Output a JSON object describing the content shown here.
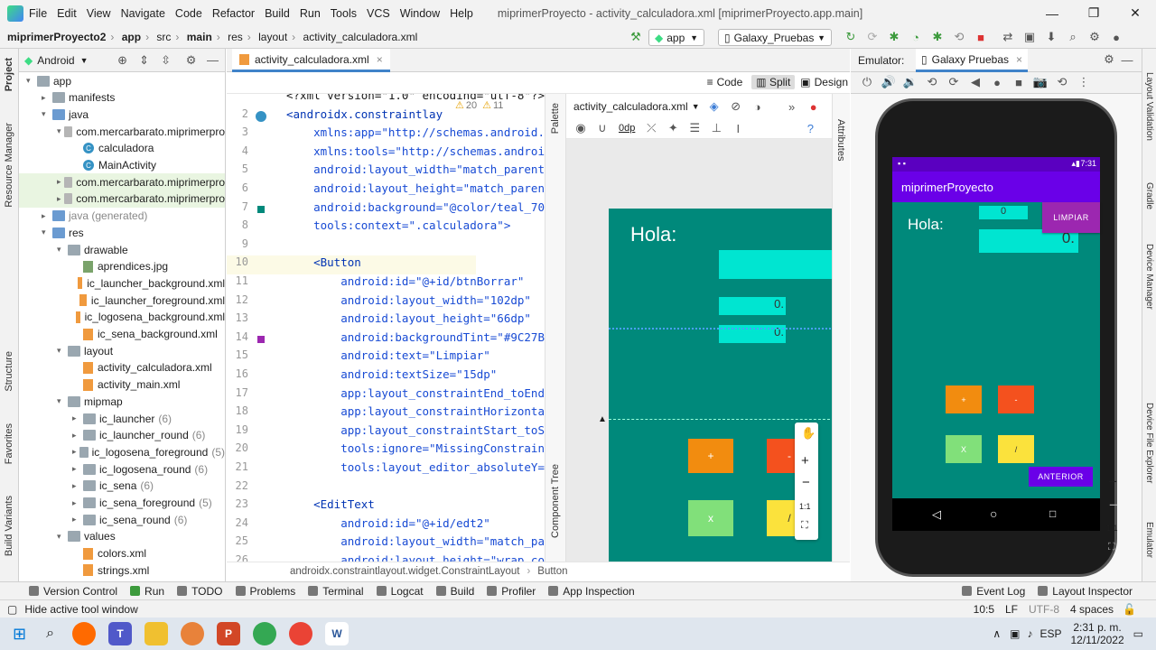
{
  "titlebar": {
    "menu": [
      "File",
      "Edit",
      "View",
      "Navigate",
      "Code",
      "Refactor",
      "Build",
      "Run",
      "Tools",
      "VCS",
      "Window",
      "Help"
    ],
    "title": "miprimerProyecto - activity_calculadora.xml [miprimerProyecto.app.main]"
  },
  "navbar": {
    "crumbs": [
      "miprimerProyecto2",
      "app",
      "src",
      "main",
      "res",
      "layout",
      "activity_calculadora.xml"
    ],
    "run_config": "app",
    "device": "Galaxy_Pruebas"
  },
  "leftstrip": {
    "tabs": [
      "Project",
      "Resource Manager",
      "Structure",
      "Favorites",
      "Build Variants"
    ]
  },
  "project": {
    "view": "Android",
    "items": [
      {
        "label": "app",
        "indent": 0,
        "kind": "folder",
        "arrow": "▾"
      },
      {
        "label": "manifests",
        "indent": 1,
        "kind": "folder",
        "arrow": "▸"
      },
      {
        "label": "java",
        "indent": 1,
        "kind": "folder",
        "arrow": "▾"
      },
      {
        "label": "com.mercarbarato.miprimerpro",
        "indent": 2,
        "kind": "pkg",
        "arrow": "▾"
      },
      {
        "label": "calculadora",
        "indent": 3,
        "kind": "class",
        "arrow": ""
      },
      {
        "label": "MainActivity",
        "indent": 3,
        "kind": "class",
        "arrow": ""
      },
      {
        "label": "com.mercarbarato.miprimerpro",
        "indent": 2,
        "kind": "pkg",
        "arrow": "▸",
        "hl": true
      },
      {
        "label": "com.mercarbarato.miprimerpro",
        "indent": 2,
        "kind": "pkg",
        "arrow": "▸",
        "hl": true
      },
      {
        "label": "java (generated)",
        "indent": 1,
        "kind": "folder",
        "arrow": "▸",
        "muted": true
      },
      {
        "label": "res",
        "indent": 1,
        "kind": "folder",
        "arrow": "▾"
      },
      {
        "label": "drawable",
        "indent": 2,
        "kind": "folder",
        "arrow": "▾"
      },
      {
        "label": "aprendices.jpg",
        "indent": 3,
        "kind": "jpg",
        "arrow": ""
      },
      {
        "label": "ic_launcher_background.xml",
        "indent": 3,
        "kind": "xml",
        "arrow": ""
      },
      {
        "label": "ic_launcher_foreground.xml",
        "indent": 3,
        "kind": "xml",
        "arrow": ""
      },
      {
        "label": "ic_logosena_background.xml",
        "indent": 3,
        "kind": "xml",
        "arrow": ""
      },
      {
        "label": "ic_sena_background.xml",
        "indent": 3,
        "kind": "xml",
        "arrow": ""
      },
      {
        "label": "layout",
        "indent": 2,
        "kind": "folder",
        "arrow": "▾"
      },
      {
        "label": "activity_calculadora.xml",
        "indent": 3,
        "kind": "xml",
        "arrow": ""
      },
      {
        "label": "activity_main.xml",
        "indent": 3,
        "kind": "xml",
        "arrow": ""
      },
      {
        "label": "mipmap",
        "indent": 2,
        "kind": "folder",
        "arrow": "▾"
      },
      {
        "label": "ic_launcher",
        "indent": 3,
        "kind": "folder",
        "arrow": "▸",
        "count": "(6)"
      },
      {
        "label": "ic_launcher_round",
        "indent": 3,
        "kind": "folder",
        "arrow": "▸",
        "count": "(6)"
      },
      {
        "label": "ic_logosena_foreground",
        "indent": 3,
        "kind": "folder",
        "arrow": "▸",
        "count": "(5)"
      },
      {
        "label": "ic_logosena_round",
        "indent": 3,
        "kind": "folder",
        "arrow": "▸",
        "count": "(6)"
      },
      {
        "label": "ic_sena",
        "indent": 3,
        "kind": "folder",
        "arrow": "▸",
        "count": "(6)"
      },
      {
        "label": "ic_sena_foreground",
        "indent": 3,
        "kind": "folder",
        "arrow": "▸",
        "count": "(5)"
      },
      {
        "label": "ic_sena_round",
        "indent": 3,
        "kind": "folder",
        "arrow": "▸",
        "count": "(6)"
      },
      {
        "label": "values",
        "indent": 2,
        "kind": "folder",
        "arrow": "▾"
      },
      {
        "label": "colors.xml",
        "indent": 3,
        "kind": "xml",
        "arrow": ""
      },
      {
        "label": "strings.xml",
        "indent": 3,
        "kind": "xml",
        "arrow": ""
      }
    ]
  },
  "editor": {
    "tab": "activity_calculadora.xml",
    "views": [
      "Code",
      "Split",
      "Design"
    ],
    "warnings": "20",
    "infos": "11",
    "lines": [
      {
        "n": "",
        "code": "<?xml version=\"1.0\" encoding=\"utf-8\"?>"
      },
      {
        "n": "2",
        "code": "<androidx.constraintlay"
      },
      {
        "n": "3",
        "code": "    xmlns:app=\"http://schemas.android."
      },
      {
        "n": "4",
        "code": "    xmlns:tools=\"http://schemas.androi"
      },
      {
        "n": "5",
        "code": "    android:layout_width=\"match_parent"
      },
      {
        "n": "6",
        "code": "    android:layout_height=\"match_paren"
      },
      {
        "n": "7",
        "code": "    android:background=\"@color/teal_70"
      },
      {
        "n": "8",
        "code": "    tools:context=\".calculadora\">"
      },
      {
        "n": "9",
        "code": ""
      },
      {
        "n": "10",
        "code": "    <Button"
      },
      {
        "n": "11",
        "code": "        android:id=\"@+id/btnBorrar\""
      },
      {
        "n": "12",
        "code": "        android:layout_width=\"102dp\""
      },
      {
        "n": "13",
        "code": "        android:layout_height=\"66dp\""
      },
      {
        "n": "14",
        "code": "        android:backgroundTint=\"#9C27B"
      },
      {
        "n": "15",
        "code": "        android:text=\"Limpiar\""
      },
      {
        "n": "16",
        "code": "        android:textSize=\"15dp\""
      },
      {
        "n": "17",
        "code": "        app:layout_constraintEnd_toEnd"
      },
      {
        "n": "18",
        "code": "        app:layout_constraintHorizonta"
      },
      {
        "n": "19",
        "code": "        app:layout_constraintStart_toS"
      },
      {
        "n": "20",
        "code": "        tools:ignore=\"MissingConstrain"
      },
      {
        "n": "21",
        "code": "        tools:layout_editor_absoluteY="
      },
      {
        "n": "22",
        "code": ""
      },
      {
        "n": "23",
        "code": "    <EditText"
      },
      {
        "n": "24",
        "code": "        android:id=\"@+id/edt2\""
      },
      {
        "n": "25",
        "code": "        android:layout_width=\"match_pa"
      },
      {
        "n": "26",
        "code": "        android:layout_height=\"wrap_co"
      }
    ],
    "breadcrumb": [
      "androidx.constraintlayout.widget.ConstraintLayout",
      "Button"
    ]
  },
  "design": {
    "file": "activity_calculadora.xml",
    "dp": "0dp",
    "palette": "Palette",
    "component_tree": "Component Tree",
    "attributes": "Attributes",
    "preview": {
      "label": "Hola:",
      "field1": "0.",
      "field2": "0.",
      "btn_plus": "+",
      "btn_minus": "-",
      "btn_x": "x",
      "btn_div": "/"
    },
    "zoom": [
      "+",
      "−",
      "1:1"
    ]
  },
  "emulator": {
    "title": "Emulator:",
    "tab": "Galaxy Pruebas",
    "phone": {
      "time": "7:31",
      "app_title": "miprimerProyecto",
      "label": "Hola:",
      "small_field": "0",
      "big_field": "0.",
      "btn_limpiar": "LIMPIAR",
      "btn_plus": "+",
      "btn_minus": "-",
      "btn_x": "X",
      "btn_div": "/",
      "btn_anterior": "ANTERIOR"
    },
    "zoom": [
      "+",
      "−",
      "1:1"
    ]
  },
  "rightstrip": [
    "Layout Validation",
    "Gradle",
    "Device Manager",
    "Device File Explorer",
    "Emulator"
  ],
  "toolwindows": [
    "Version Control",
    "Run",
    "TODO",
    "Problems",
    "Terminal",
    "Logcat",
    "Build",
    "Profiler",
    "App Inspection"
  ],
  "toolwindows_right": [
    "Event Log",
    "Layout Inspector"
  ],
  "status": {
    "message": "Hide active tool window",
    "pos": "10:5",
    "lf": "LF",
    "enc": "UTF-8",
    "indent": "4 spaces"
  },
  "taskbar": {
    "lang": "ESP",
    "time": "2:31 p. m.",
    "date": "12/11/2022"
  },
  "colors": {
    "teal": "#00897b",
    "cyan_field": "#00e5d1",
    "purple": "#9c27b0",
    "purple_btn": "#6a00e8",
    "orange": "#f28c0f",
    "red_orange": "#f4511e",
    "green_light": "#81e07a",
    "yellow": "#fbe23c"
  }
}
